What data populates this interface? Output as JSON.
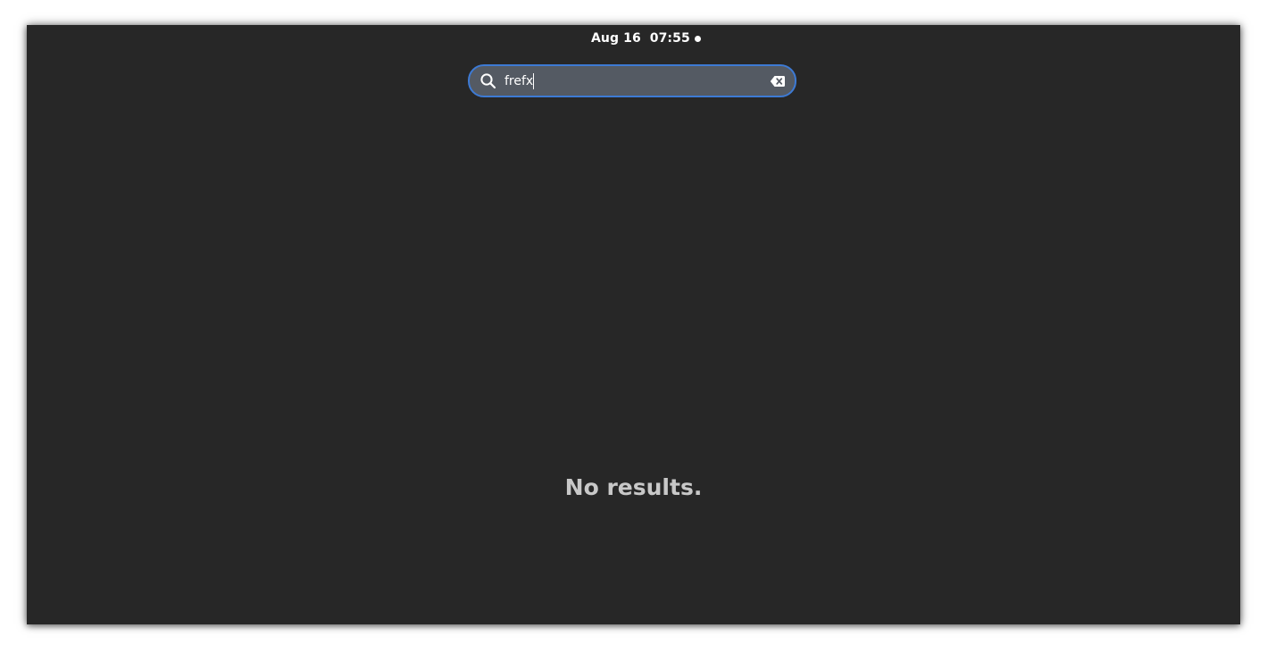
{
  "topbar": {
    "clock": "Aug 16  07:55",
    "notification_indicator": "dot"
  },
  "search": {
    "value": "frefx",
    "icon": "search-icon",
    "clear_icon": "clear-text-icon"
  },
  "results": {
    "empty_message": "No results."
  },
  "colors": {
    "background": "#272727",
    "search_field": "#545a63",
    "focus_ring": "#3d7ad4",
    "message_text": "#c8c8c8"
  }
}
